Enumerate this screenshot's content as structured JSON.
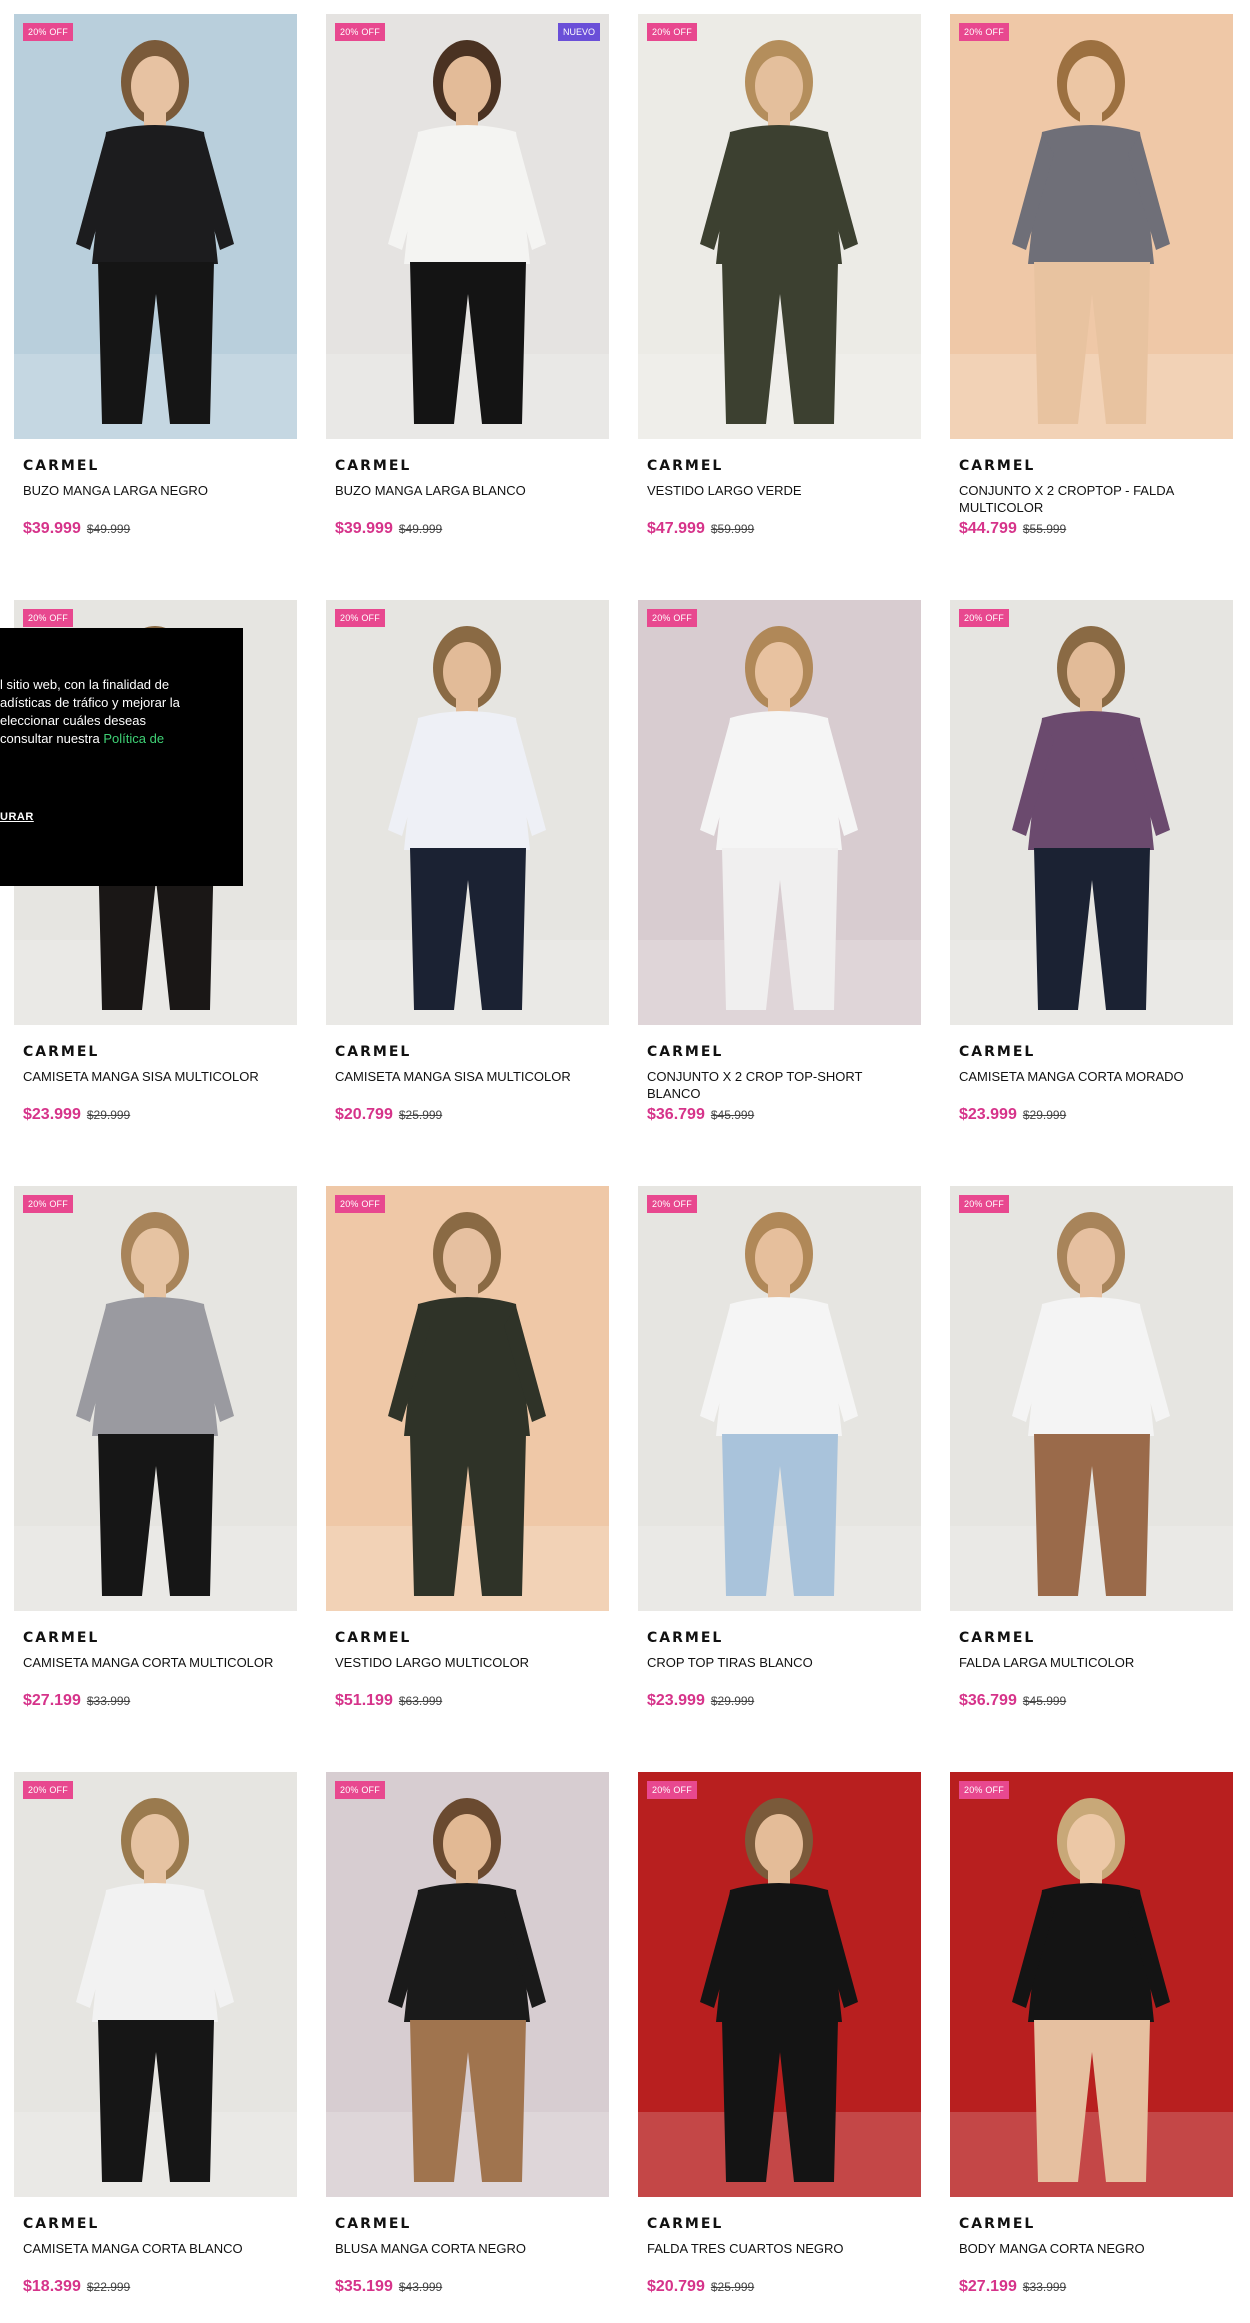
{
  "products": [
    {
      "brand": "CARMEL",
      "name": "BUZO MANGA LARGA NEGRO",
      "price": "$39.999",
      "old": "$49.999",
      "badge": "20% OFF",
      "bg": "#b9cfdc",
      "outfit": "#1c1c1e",
      "legs": "#151515",
      "skin": "#e7c2a2",
      "hair": "#7a5a3a"
    },
    {
      "brand": "CARMEL",
      "name": "BUZO MANGA LARGA BLANCO",
      "price": "$39.999",
      "old": "$49.999",
      "badge": "20% OFF",
      "badge2": "NUEVO",
      "bg": "#e5e3e1",
      "outfit": "#f4f4f2",
      "legs": "#141414",
      "skin": "#e3bb98",
      "hair": "#4a3222"
    },
    {
      "brand": "CARMEL",
      "name": "VESTIDO LARGO VERDE",
      "price": "$47.999",
      "old": "$59.999",
      "badge": "20% OFF",
      "bg": "#ecebe6",
      "outfit": "#3c4030",
      "legs": "#3c4030",
      "skin": "#e4bf9c",
      "hair": "#b48e5c"
    },
    {
      "brand": "CARMEL",
      "name": "CONJUNTO X 2 CROPTOP - FALDA MULTICOLOR",
      "price": "$44.799",
      "old": "$55.999",
      "badge": "20% OFF",
      "bg": "#efc8a7",
      "outfit": "#6f6f78",
      "legs": "#e8c3a0",
      "skin": "#ecc6a4",
      "hair": "#9c7040"
    },
    {
      "brand": "CARMEL",
      "name": "CAMISETA MANGA SISA MULTICOLOR",
      "price": "$23.999",
      "old": "$29.999",
      "badge": "20% OFF",
      "bg": "#e6e5e1",
      "outfit": "#e9e8e6",
      "legs": "#1a1716",
      "skin": "#e2bb98",
      "hair": "#8a6a44"
    },
    {
      "brand": "CARMEL",
      "name": "CAMISETA MANGA SISA MULTICOLOR",
      "price": "$20.799",
      "old": "$25.999",
      "badge": "20% OFF",
      "bg": "#e6e5e1",
      "outfit": "#eef0f6",
      "legs": "#1b2233",
      "skin": "#e2bb98",
      "hair": "#8a6a44"
    },
    {
      "brand": "CARMEL",
      "name": "CONJUNTO X 2 CROP TOP-SHORT BLANCO",
      "price": "$36.799",
      "old": "$45.999",
      "badge": "20% OFF",
      "bg": "#d8ccd0",
      "outfit": "#f5f5f5",
      "legs": "#f0efef",
      "skin": "#e8c2a0",
      "hair": "#b08858"
    },
    {
      "brand": "CARMEL",
      "name": "CAMISETA MANGA CORTA MORADO",
      "price": "$23.999",
      "old": "$29.999",
      "badge": "20% OFF",
      "bg": "#e6e5e1",
      "outfit": "#6b4a6e",
      "legs": "#1b2233",
      "skin": "#e2bb98",
      "hair": "#8a6a44"
    },
    {
      "brand": "CARMEL",
      "name": "CAMISETA MANGA CORTA MULTICOLOR",
      "price": "$27.199",
      "old": "$33.999",
      "badge": "20% OFF",
      "bg": "#e6e5e1",
      "outfit": "#9a9aa0",
      "legs": "#161616",
      "skin": "#e6c3a2",
      "hair": "#a8845a"
    },
    {
      "brand": "CARMEL",
      "name": "VESTIDO LARGO MULTICOLOR",
      "price": "$51.199",
      "old": "$63.999",
      "badge": "20% OFF",
      "bg": "#efc8a7",
      "outfit": "#2f3328",
      "legs": "#2f3328",
      "skin": "#e6c0a0",
      "hair": "#8a6a44"
    },
    {
      "brand": "CARMEL",
      "name": "CROP TOP TIRAS BLANCO",
      "price": "$23.999",
      "old": "$29.999",
      "badge": "20% OFF",
      "bg": "#e6e5e1",
      "outfit": "#f5f5f5",
      "legs": "#a9c3db",
      "skin": "#e6bf9c",
      "hair": "#b08858"
    },
    {
      "brand": "CARMEL",
      "name": "FALDA LARGA MULTICOLOR",
      "price": "$36.799",
      "old": "$45.999",
      "badge": "20% OFF",
      "bg": "#e6e5e1",
      "outfit": "#f4f4f4",
      "legs": "#9a6a4a",
      "skin": "#e6c0a0",
      "hair": "#a8845a"
    },
    {
      "brand": "CARMEL",
      "name": "CAMISETA MANGA CORTA BLANCO",
      "price": "$18.399",
      "old": "$22.999",
      "badge": "20% OFF",
      "bg": "#e6e5e1",
      "outfit": "#f2f2f2",
      "legs": "#161616",
      "skin": "#e6c3a2",
      "hair": "#9a7a4e"
    },
    {
      "brand": "CARMEL",
      "name": "BLUSA MANGA CORTA NEGRO",
      "price": "$35.199",
      "old": "$43.999",
      "badge": "20% OFF",
      "bg": "#d7cdd1",
      "outfit": "#1a1a1a",
      "legs": "#a0744e",
      "skin": "#e2b994",
      "hair": "#6a4a30"
    },
    {
      "brand": "CARMEL",
      "name": "FALDA TRES CUARTOS NEGRO",
      "price": "$20.799",
      "old": "$25.999",
      "badge": "20% OFF",
      "bg": "#b81f1f",
      "outfit": "#141414",
      "legs": "#141414",
      "skin": "#e4bc98",
      "hair": "#7a5a3a"
    },
    {
      "brand": "CARMEL",
      "name": "BODY MANGA CORTA NEGRO",
      "price": "$27.199",
      "old": "$33.999",
      "badge": "20% OFF",
      "bg": "#b81f1f",
      "outfit": "#141414",
      "legs": "#e6c0a0",
      "skin": "#ecc8a6",
      "hair": "#c8a878"
    }
  ],
  "cookie": {
    "text": "l sitio web, con la finalidad de\nadísticas de tráfico y mejorar la\neleccionar cuáles deseas\nconsultar nuestra ",
    "link": "Política de",
    "configure": "URAR"
  }
}
